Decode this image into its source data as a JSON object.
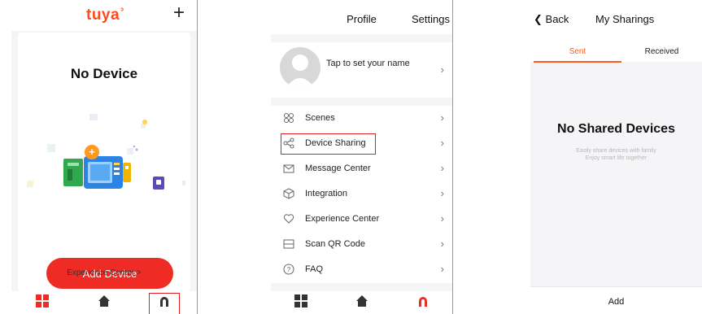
{
  "screen1": {
    "logo": "tuya",
    "empty_title": "No Device",
    "add_button": "Add Device",
    "experience_link": "Experience Center >",
    "tabs": [
      {
        "name": "devices",
        "icon": "grid-icon"
      },
      {
        "name": "smart",
        "icon": "home-icon"
      },
      {
        "name": "me",
        "icon": "profile-icon",
        "highlighted": true
      }
    ]
  },
  "screen2": {
    "title": "Profile",
    "settings": "Settings",
    "profile_prompt": "Tap to set your name",
    "menu": [
      {
        "label": "Scenes",
        "icon": "scenes-icon"
      },
      {
        "label": "Device Sharing",
        "icon": "share-icon",
        "highlighted": true
      },
      {
        "label": "Message Center",
        "icon": "mail-icon"
      },
      {
        "label": "Integration",
        "icon": "cube-icon"
      },
      {
        "label": "Experience Center",
        "icon": "heart-icon"
      },
      {
        "label": "Scan QR Code",
        "icon": "scan-icon"
      },
      {
        "label": "FAQ",
        "icon": "question-icon"
      }
    ]
  },
  "screen3": {
    "back": "Back",
    "title": "My Sharings",
    "tabs": [
      {
        "label": "Sent",
        "active": true
      },
      {
        "label": "Received",
        "active": false
      }
    ],
    "empty_title": "No Shared Devices",
    "desc_line1": "Easily share devices with family",
    "desc_line2": "Enjoy smart life together",
    "add": "Add"
  },
  "colors": {
    "brand_orange": "#ff4a1a",
    "add_button_red": "#ef2b26",
    "highlight_red": "#e02020",
    "tab_active": "#ff5a1f",
    "background": "#f5f5f7"
  }
}
